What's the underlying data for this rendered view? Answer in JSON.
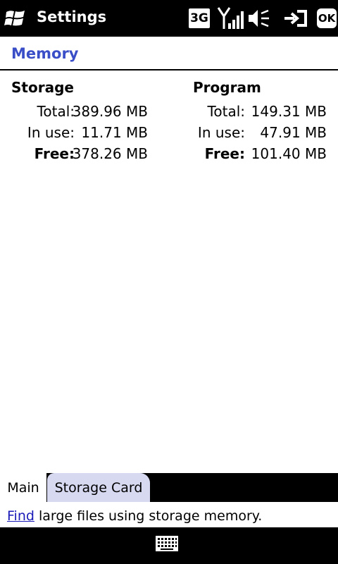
{
  "titlebar": {
    "title": "Settings",
    "network": "3G",
    "ok_label": "OK"
  },
  "section": {
    "title": "Memory"
  },
  "storage": {
    "heading": "Storage",
    "total_label": "Total:",
    "total_value": "389.96 MB",
    "inuse_label": "In use:",
    "inuse_value": "11.71 MB",
    "free_label": "Free:",
    "free_value": "378.26 MB"
  },
  "program": {
    "heading": "Program",
    "total_label": "Total:",
    "total_value": "149.31 MB",
    "inuse_label": "In use:",
    "inuse_value": "47.91 MB",
    "free_label": "Free:",
    "free_value": "101.40 MB"
  },
  "tabs": [
    {
      "label": "Main",
      "active": true
    },
    {
      "label": "Storage Card",
      "active": false
    }
  ],
  "help": {
    "link_text": "Find",
    "rest_text": " large files using storage memory."
  },
  "icons": {
    "start": "windows-logo-icon",
    "signal": "signal-strength-icon",
    "volume": "speaker-muted-icon",
    "connection": "data-connection-icon",
    "keyboard": "keyboard-icon"
  },
  "colors": {
    "accent": "#3a4ec8",
    "link": "#1a1ab8",
    "inactive_tab": "#d6d9f0"
  }
}
